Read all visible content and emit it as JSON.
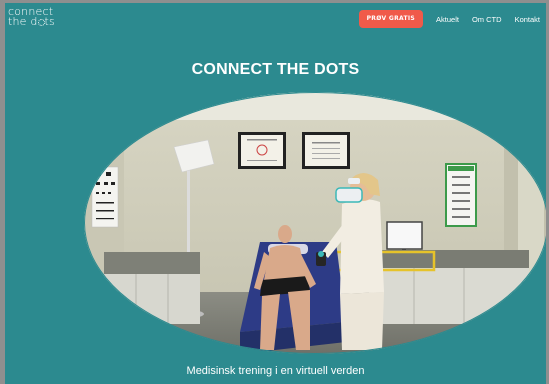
{
  "header": {
    "logo_line1": "connect",
    "logo_line2_prefix": "the d",
    "logo_line2_suffix": "ts"
  },
  "nav": {
    "cta_label": "PRØV GRATIS",
    "links": [
      {
        "label": "Aktuelt"
      },
      {
        "label": "Om CTD"
      },
      {
        "label": "Kontakt"
      }
    ]
  },
  "hero": {
    "title": "CONNECT THE DOTS",
    "image_icon": "vr-medical-training-scene",
    "tagline": "Medisinsk trening i en virtuell verden"
  },
  "colors": {
    "page_background": "#2c8a8f",
    "cta_background": "#f05a4a",
    "outer_background": "#8f8f8f"
  }
}
